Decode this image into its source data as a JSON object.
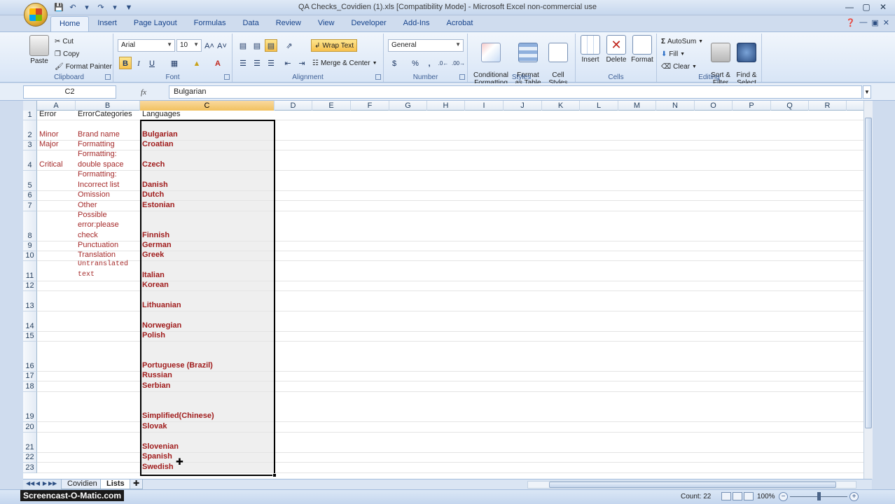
{
  "window": {
    "title": "QA Checks_Covidien (1).xls  [Compatibility Mode] - Microsoft Excel non-commercial use",
    "qat": [
      "save-icon",
      "undo-icon",
      "redo-icon",
      "customize-icon"
    ]
  },
  "tabs": [
    "Home",
    "Insert",
    "Page Layout",
    "Formulas",
    "Data",
    "Review",
    "View",
    "Developer",
    "Add-Ins",
    "Acrobat"
  ],
  "active_tab": "Home",
  "ribbon": {
    "clipboard": {
      "label": "Clipboard",
      "paste": "Paste",
      "cut": "Cut",
      "copy": "Copy",
      "format_painter": "Format Painter"
    },
    "font": {
      "label": "Font",
      "name": "Arial",
      "size": "10",
      "bold": "B",
      "italic": "I",
      "underline": "U"
    },
    "alignment": {
      "label": "Alignment",
      "wrap_text": "Wrap Text",
      "merge_center": "Merge & Center"
    },
    "number": {
      "label": "Number",
      "format": "General",
      "percent": "%",
      "comma": ","
    },
    "styles": {
      "label": "Styles",
      "conditional": "Conditional\nFormatting",
      "format_table": "Format\nas Table",
      "cell_styles": "Cell\nStyles"
    },
    "cells": {
      "label": "Cells",
      "insert": "Insert",
      "delete": "Delete",
      "format": "Format"
    },
    "editing": {
      "label": "Editing",
      "autosum": "AutoSum",
      "fill": "Fill",
      "clear": "Clear",
      "sort_filter": "Sort &\nFilter",
      "find_select": "Find &\nSelect"
    }
  },
  "formula_bar": {
    "name_box": "C2",
    "fx": "fx",
    "value": "Bulgarian"
  },
  "columns": [
    "A",
    "B",
    "C",
    "D",
    "E",
    "F",
    "G",
    "H",
    "I",
    "J",
    "K",
    "L",
    "M",
    "N",
    "O",
    "P",
    "Q",
    "R"
  ],
  "selected_column": "C",
  "rows": [
    {
      "n": "1",
      "a": "Error",
      "b": "ErrorCategories",
      "c": "Languages"
    },
    {
      "n": "2",
      "a": "Minor",
      "b": "Brand name",
      "c": "Bulgarian"
    },
    {
      "n": "3",
      "a": "Major",
      "b": "Formatting",
      "c": "Croatian"
    },
    {
      "n": "4",
      "a": "Critical",
      "b": "Formatting:\ndouble space",
      "c": "Czech"
    },
    {
      "n": "5",
      "a": "",
      "b": "Formatting:\nIncorrect list",
      "c": "Danish"
    },
    {
      "n": "6",
      "a": "",
      "b": "Omission",
      "c": "Dutch"
    },
    {
      "n": "7",
      "a": "",
      "b": "Other",
      "c": "Estonian"
    },
    {
      "n": "8",
      "a": "",
      "b": "Possible\nerror:please\ncheck",
      "c": "Finnish"
    },
    {
      "n": "9",
      "a": "",
      "b": "Punctuation",
      "c": "German"
    },
    {
      "n": "10",
      "a": "",
      "b": "Translation",
      "c": "Greek"
    },
    {
      "n": "11",
      "a": "",
      "b": "Untranslated\ntext",
      "c": "Italian"
    },
    {
      "n": "12",
      "a": "",
      "b": "",
      "c": "Korean"
    },
    {
      "n": "13",
      "a": "",
      "b": "",
      "c": "Lithuanian"
    },
    {
      "n": "14",
      "a": "",
      "b": "",
      "c": "Norwegian"
    },
    {
      "n": "15",
      "a": "",
      "b": "",
      "c": "Polish"
    },
    {
      "n": "16",
      "a": "",
      "b": "",
      "c": "Portuguese (Brazil)"
    },
    {
      "n": "17",
      "a": "",
      "b": "",
      "c": "Russian"
    },
    {
      "n": "18",
      "a": "",
      "b": "",
      "c": "Serbian"
    },
    {
      "n": "19",
      "a": "",
      "b": "",
      "c": "Simplified(Chinese)"
    },
    {
      "n": "20",
      "a": "",
      "b": "",
      "c": "Slovak"
    },
    {
      "n": "21",
      "a": "",
      "b": "",
      "c": "Slovenian"
    },
    {
      "n": "22",
      "a": "",
      "b": "",
      "c": "Spanish"
    },
    {
      "n": "23",
      "a": "",
      "b": "",
      "c": "Swedish"
    }
  ],
  "sheets": [
    "Covidien",
    "Lists"
  ],
  "active_sheet": "Lists",
  "status": {
    "count": "Count: 22",
    "zoom": "100%",
    "watermark": "Screencast-O-Matic.com"
  },
  "colors": {
    "accent": "#15428b",
    "text_red": "#a01c1c",
    "selection": "#f1c15f"
  }
}
